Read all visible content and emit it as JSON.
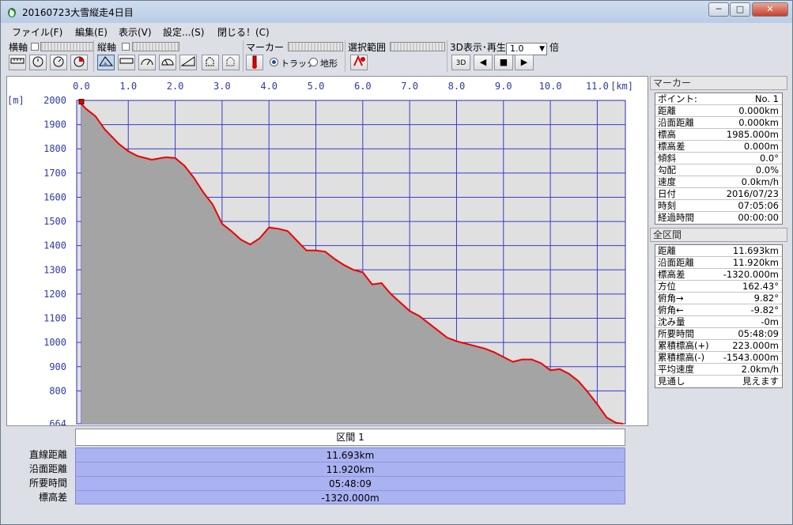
{
  "window": {
    "title": "20160723大雪縦走4日目",
    "buttons": {
      "minimize": "─",
      "maximize": "□",
      "close": "✕"
    },
    "app_icon": "penguin-app-icon"
  },
  "menu": [
    {
      "label": "ファイル(F)"
    },
    {
      "label": "編集(E)"
    },
    {
      "label": "表示(V)"
    },
    {
      "label": "設定...(S)"
    },
    {
      "label": "閉じる！(C)"
    }
  ],
  "toolbar": {
    "horizontal_axis_label": "横軸",
    "vertical_axis_label": "縦軸",
    "marker_label": "マーカー",
    "range_label": "選択範囲",
    "view3d_label": "3D表示･再生",
    "track_radio": "トラック",
    "terrain_radio": "地形",
    "speed_value": "1.0",
    "speed_unit": "倍",
    "btn_3d_label": "3D"
  },
  "chart_data": {
    "type": "area",
    "xlabel": "[km]",
    "ylabel": "[m]",
    "xlim": [
      -0.1,
      11.6
    ],
    "ylim": [
      664,
      2000
    ],
    "x_ticks": [
      "0.0",
      "1.0",
      "2.0",
      "3.0",
      "4.0",
      "5.0",
      "6.0",
      "7.0",
      "8.0",
      "9.0",
      "10.0",
      "11.0"
    ],
    "y_ticks": [
      "2000",
      "1900",
      "1800",
      "1700",
      "1600",
      "1500",
      "1400",
      "1300",
      "1200",
      "1100",
      "1000",
      "900",
      "800",
      "664"
    ],
    "series": [
      {
        "color": "#ee0000",
        "x": [
          0.0,
          0.1,
          0.3,
          0.5,
          0.8,
          1.0,
          1.2,
          1.5,
          1.8,
          2.0,
          2.2,
          2.4,
          2.6,
          2.8,
          3.0,
          3.2,
          3.4,
          3.6,
          3.8,
          4.0,
          4.2,
          4.4,
          4.6,
          4.8,
          5.0,
          5.2,
          5.4,
          5.6,
          5.8,
          6.0,
          6.2,
          6.4,
          6.6,
          6.8,
          7.0,
          7.2,
          7.4,
          7.6,
          7.8,
          8.0,
          8.2,
          8.4,
          8.6,
          8.8,
          9.0,
          9.2,
          9.4,
          9.6,
          9.8,
          10.0,
          10.2,
          10.4,
          10.6,
          10.8,
          11.0,
          11.2,
          11.4,
          11.55
        ],
        "y": [
          1985,
          1965,
          1935,
          1880,
          1820,
          1790,
          1770,
          1755,
          1765,
          1762,
          1730,
          1680,
          1620,
          1570,
          1490,
          1460,
          1425,
          1405,
          1430,
          1475,
          1470,
          1460,
          1420,
          1380,
          1380,
          1375,
          1345,
          1320,
          1300,
          1290,
          1240,
          1245,
          1200,
          1165,
          1130,
          1110,
          1080,
          1050,
          1020,
          1005,
          995,
          985,
          975,
          960,
          940,
          920,
          930,
          930,
          915,
          885,
          890,
          870,
          840,
          795,
          745,
          690,
          668,
          664
        ]
      }
    ]
  },
  "summary": {
    "header": "区間 1",
    "rows": [
      {
        "label": "直線距離",
        "value": "11.693km"
      },
      {
        "label": "沿面距離",
        "value": "11.920km"
      },
      {
        "label": "所要時間",
        "value": "05:48:09"
      },
      {
        "label": "標高差",
        "value": "-1320.000m"
      }
    ]
  },
  "marker_panel": {
    "title": "マーカー",
    "rows": [
      {
        "k": "ポイント:",
        "v": "No. 1"
      },
      {
        "k": "距離",
        "v": "0.000km"
      },
      {
        "k": "沿面距離",
        "v": "0.000km"
      },
      {
        "k": "標高",
        "v": "1985.000m"
      },
      {
        "k": "標高差",
        "v": "0.000m"
      },
      {
        "k": "傾斜",
        "v": "0.0°"
      },
      {
        "k": "勾配",
        "v": "0.0%"
      },
      {
        "k": "速度",
        "v": "0.0km/h"
      },
      {
        "k": "日付",
        "v": "2016/07/23"
      },
      {
        "k": "時刻",
        "v": "07:05:06"
      },
      {
        "k": "経過時間",
        "v": "00:00:00"
      }
    ]
  },
  "total_panel": {
    "title": "全区間",
    "rows": [
      {
        "k": "距離",
        "v": "11.693km"
      },
      {
        "k": "沿面距離",
        "v": "11.920km"
      },
      {
        "k": "標高差",
        "v": "-1320.000m"
      },
      {
        "k": "方位",
        "v": "162.43°"
      },
      {
        "k": "俯角→",
        "v": "9.82°"
      },
      {
        "k": "俯角←",
        "v": "-9.82°"
      },
      {
        "k": "沈み量",
        "v": "-0m"
      },
      {
        "k": "所要時間",
        "v": "05:48:09"
      },
      {
        "k": "累積標高(+)",
        "v": "223.000m"
      },
      {
        "k": "累積標高(-)",
        "v": "-1543.000m"
      },
      {
        "k": "平均速度",
        "v": "2.0km/h"
      },
      {
        "k": "見通し",
        "v": "見えます"
      }
    ]
  }
}
